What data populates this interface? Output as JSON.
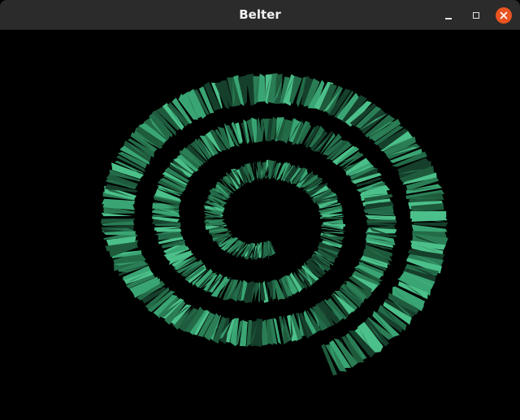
{
  "window": {
    "title": "Belter"
  },
  "controls": {
    "close_color": "#e95420"
  },
  "scene": {
    "background": "#000000",
    "palette": [
      "#1e5a3c",
      "#2a7d55",
      "#3aa574",
      "#153f2b",
      "#4cc08a",
      "#236b48"
    ]
  }
}
